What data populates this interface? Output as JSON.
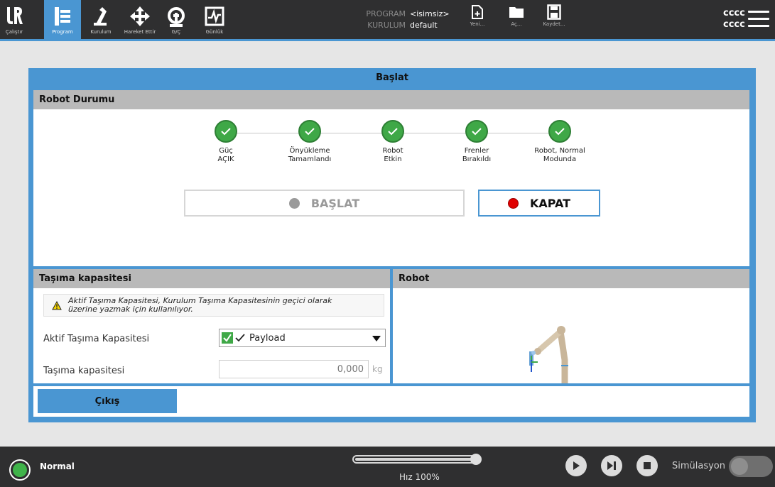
{
  "topbar": {
    "nav": [
      {
        "label": "Çalıştır",
        "icon": "ur-logo-icon"
      },
      {
        "label": "Program",
        "icon": "program-tree-icon"
      },
      {
        "label": "Kurulum",
        "icon": "robot-arm-icon"
      },
      {
        "label": "Hareket Ettir",
        "icon": "move-arrows-icon"
      },
      {
        "label": "G/Ç",
        "icon": "io-icon"
      },
      {
        "label": "Günlük",
        "icon": "log-icon"
      }
    ],
    "program_key": "PROGRAM",
    "program_value": "<isimsiz>",
    "installation_key": "KURULUM",
    "installation_value": "default",
    "file_buttons": [
      {
        "label": "Yeni...",
        "icon": "new-file-icon"
      },
      {
        "label": "Aç...",
        "icon": "folder-icon"
      },
      {
        "label": "Kaydet...",
        "icon": "save-icon"
      }
    ],
    "user_line1": "cccc",
    "user_line2": "cccc"
  },
  "dialog": {
    "title": "Başlat",
    "robot_status": {
      "header": "Robot Durumu",
      "steps": [
        {
          "line1": "Güç",
          "line2": "AÇIK"
        },
        {
          "line1": "Önyükleme",
          "line2": "Tamamlandı"
        },
        {
          "line1": "Robot",
          "line2": "Etkin"
        },
        {
          "line1": "Frenler",
          "line2": "Bırakıldı"
        },
        {
          "line1": "Robot, Normal",
          "line2": "Modunda"
        }
      ],
      "start_label": "BAŞLAT",
      "off_label": "KAPAT"
    },
    "payload": {
      "header": "Taşıma kapasitesi",
      "warning_line1": "Aktif Taşıma Kapasitesi, Kurulum Taşıma Kapasitesinin geçici olarak",
      "warning_line2": "üzerine yazmak için kullanılıyor.",
      "active_label": "Aktif Taşıma Kapasitesi",
      "active_value": "Payload",
      "mass_label": "Taşıma kapasitesi",
      "mass_value": "0,000",
      "mass_unit": "kg"
    },
    "robot_panel": {
      "header": "Robot"
    },
    "exit_label": "Çıkış"
  },
  "bottombar": {
    "status": "Normal",
    "speed_label": "Hız 100%",
    "speed_fraction": 1.0,
    "simulation_label": "Simülasyon"
  },
  "colors": {
    "accent": "#4a96d2",
    "ok_green": "#3fa847",
    "stop_red": "#e00000"
  }
}
